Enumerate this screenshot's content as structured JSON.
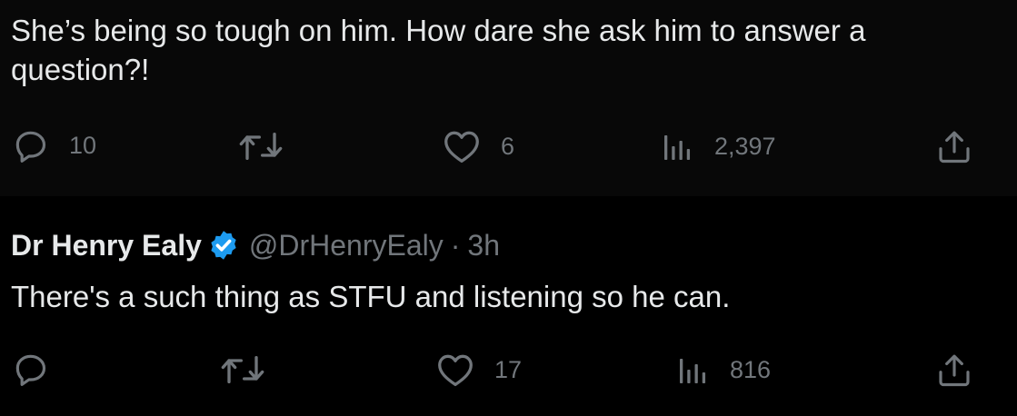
{
  "top_tweet": {
    "text": "She’s being so tough on him. How dare she ask him to answer a question?!",
    "actions": {
      "reply_count": "10",
      "retweet_count": "",
      "like_count": "6",
      "view_count": "2,397"
    }
  },
  "reply_tweet": {
    "author": {
      "display_name": "Dr Henry Ealy",
      "handle": "@DrHenryEaly",
      "separator": "·",
      "time": "3h",
      "verified_color": "#1d9bf0"
    },
    "text": "There's a such thing as STFU and listening so he can.",
    "actions": {
      "reply_count": "",
      "retweet_count": "",
      "like_count": "17",
      "view_count": "816"
    }
  },
  "icons": {
    "reply": "reply-icon",
    "retweet": "retweet-icon",
    "like": "heart-icon",
    "views": "analytics-icon",
    "share": "share-icon",
    "verified": "verified-badge-icon"
  },
  "colors": {
    "background_top": "#080808",
    "background_bottom": "#000000",
    "text": "#e7e9ea",
    "muted": "#71767b",
    "verified": "#1d9bf0"
  }
}
